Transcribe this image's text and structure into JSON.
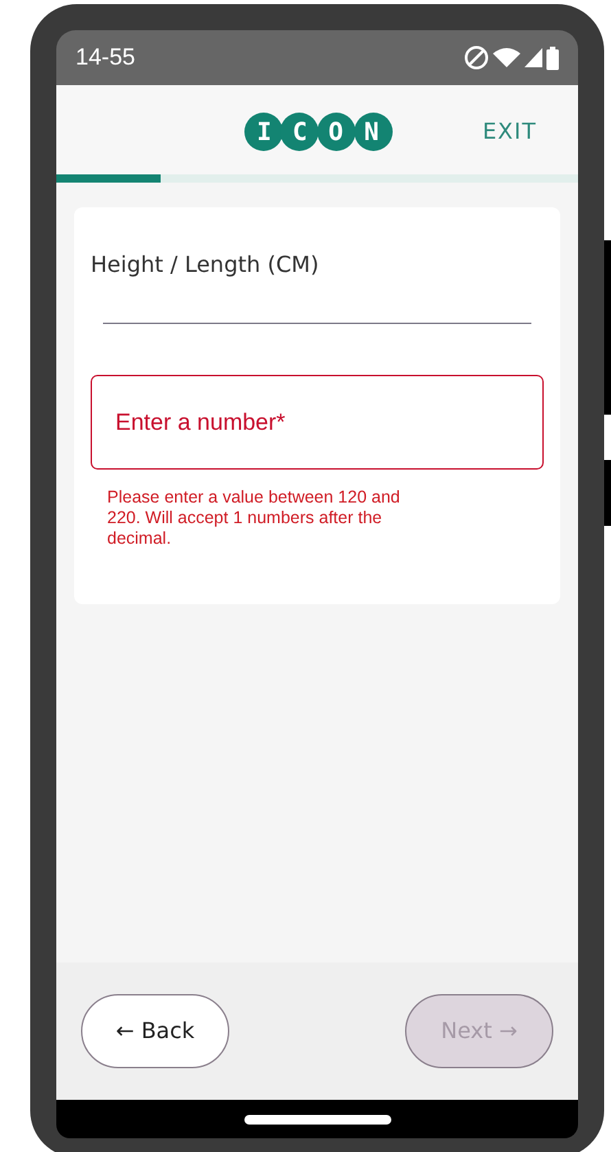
{
  "status_bar": {
    "time": "14-55"
  },
  "header": {
    "logo": "ICON",
    "exit": "EXIT"
  },
  "progress": {
    "level": 0.2
  },
  "question": {
    "label": "Height / Length (CM)"
  },
  "field": {
    "placeholder": "Enter a number*",
    "invalid": true,
    "error": "Please enter a value between 120 and 220. Will accept 1 numbers after the decimal."
  },
  "footer": {
    "back": {
      "label": "← Back",
      "disabled": false
    },
    "next": {
      "label": "Next →",
      "disabled": true
    }
  }
}
